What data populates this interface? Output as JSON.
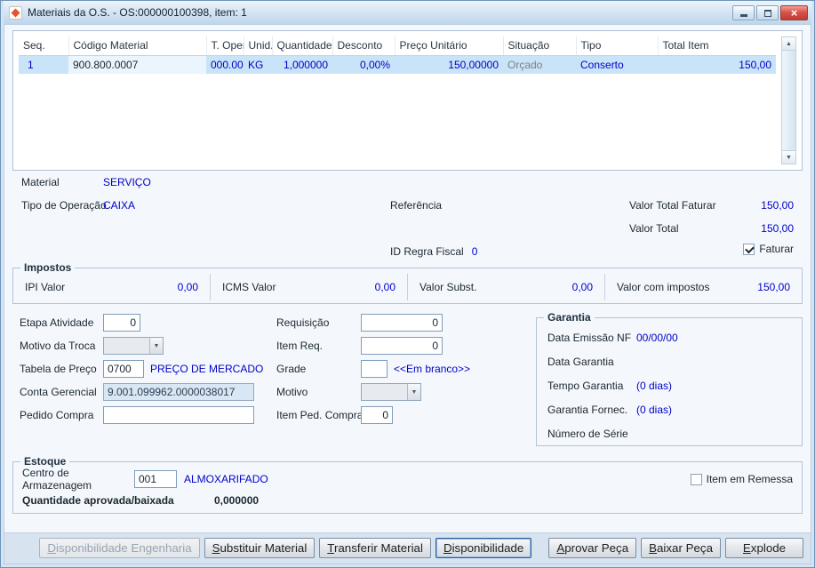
{
  "window": {
    "title": "Materiais da O.S. - OS:000000100398, item: 1"
  },
  "icons": {
    "close": "×",
    "scroll_up": "▲",
    "scroll_down": "▼",
    "dropdown_arrow": "▼"
  },
  "colors": {
    "value_blue": "#0000c8",
    "muted_gray": "#808080",
    "selected_row": "#c9e4f8"
  },
  "grid": {
    "columns": [
      "Seq.",
      "Código Material",
      "T. Oper",
      "Unid.",
      "Quantidade",
      "Desconto",
      "Preço Unitário",
      "Situação",
      "Tipo",
      "Total Item"
    ],
    "rows": [
      {
        "seq": "1",
        "codigo_material": "900.800.0007",
        "t_oper": "000.00",
        "unid": "KG",
        "quantidade": "1,000000",
        "desconto": "0,00%",
        "preco_unitario": "150,00000",
        "situacao": "Orçado",
        "tipo": "Conserto",
        "total_item": "150,00"
      }
    ]
  },
  "details": {
    "material_label": "Material",
    "material_value": "SERVIÇO",
    "tipo_operacao_label": "Tipo de Operação",
    "tipo_operacao_value": "CAIXA",
    "referencia_label": "Referência",
    "valor_total_faturar_label": "Valor Total Faturar",
    "valor_total_faturar_value": "150,00",
    "valor_total_label": "Valor Total",
    "valor_total_value": "150,00",
    "id_regra_fiscal_label": "ID Regra Fiscal",
    "id_regra_fiscal_value": "0",
    "faturar_label": "Faturar"
  },
  "impostos": {
    "legend": "Impostos",
    "items": [
      {
        "label": "IPI Valor",
        "value": "0,00"
      },
      {
        "label": "ICMS Valor",
        "value": "0,00"
      },
      {
        "label": "Valor Subst.",
        "value": "0,00"
      },
      {
        "label": "Valor com impostos",
        "value": "150,00"
      }
    ]
  },
  "form": {
    "etapa_atividade_label": "Etapa Atividade",
    "etapa_atividade_value": "0",
    "motivo_troca_label": "Motivo da Troca",
    "motivo_troca_value": "",
    "tabela_preco_label": "Tabela de Preço",
    "tabela_preco_value": "0700",
    "tabela_preco_desc": "PREÇO DE MERCADO",
    "conta_gerencial_label": "Conta Gerencial",
    "conta_gerencial_value": "9.001.099962.0000038017",
    "pedido_compra_label": "Pedido Compra",
    "pedido_compra_value": "",
    "requisicao_label": "Requisição",
    "requisicao_value": "0",
    "item_req_label": "Item Req.",
    "item_req_value": "0",
    "grade_label": "Grade",
    "grade_value": "",
    "grade_desc": "<<Em branco>>",
    "motivo_label": "Motivo",
    "motivo_value": "",
    "item_ped_compra_label": "Item Ped. Compra",
    "item_ped_compra_value": "0"
  },
  "garantia": {
    "legend": "Garantia",
    "rows": [
      {
        "label": "Data Emissão NF",
        "value": "00/00/00"
      },
      {
        "label": "Data Garantia",
        "value": ""
      },
      {
        "label": "Tempo Garantia",
        "value": "(0 dias)"
      },
      {
        "label": "Garantia Fornec.",
        "value": "(0 dias)"
      },
      {
        "label": "Número de Série",
        "value": ""
      }
    ]
  },
  "estoque": {
    "legend": "Estoque",
    "centro_label": "Centro de Armazenagem",
    "centro_value": "001",
    "centro_desc": "ALMOXARIFADO",
    "item_remessa_label": "Item em Remessa",
    "qtd_label": "Quantidade aprovada/baixada",
    "qtd_value": "0,000000"
  },
  "footer_buttons": [
    "Disponibilidade Engenharia",
    "Substituir Material",
    "Transferir Material",
    "Disponibilidade",
    "Aprovar Peça",
    "Baixar Peça",
    "Explode"
  ]
}
